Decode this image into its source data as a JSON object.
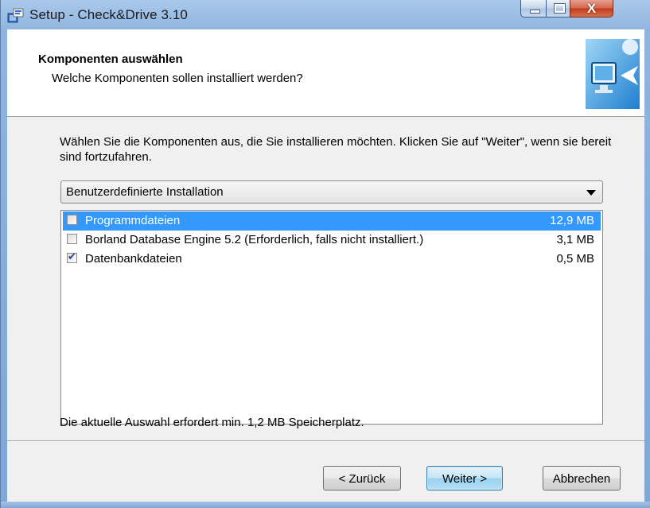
{
  "window": {
    "title": "Setup - Check&Drive 3.10",
    "app_icon": "installer-icon",
    "controls": {
      "minimize": "minimize-icon",
      "maximize": "maximize-icon",
      "close_glyph": "X"
    }
  },
  "header": {
    "title": "Komponenten auswählen",
    "subtitle": "Welche Komponenten sollen installiert werden?",
    "image": "monitor-arrow-icon"
  },
  "body": {
    "description": "Wählen Sie die Komponenten aus, die Sie installieren möchten. Klicken Sie auf \"Weiter\", wenn sie bereit sind fortzufahren.",
    "install_type": {
      "selected": "Benutzerdefinierte Installation"
    },
    "components": [
      {
        "label": "Programmdateien",
        "size": "12,9 MB",
        "checked": false,
        "selected": true
      },
      {
        "label": "Borland Database Engine 5.2 (Erforderlich, falls nicht installiert.)",
        "size": "3,1 MB",
        "checked": false,
        "selected": false
      },
      {
        "label": "Datenbankdateien",
        "size": "0,5 MB",
        "checked": true,
        "selected": false
      }
    ],
    "space_info": "Die aktuelle Auswahl erfordert min. 1,2 MB Speicherplatz."
  },
  "buttons": {
    "back": "< Zurück",
    "next": "Weiter >",
    "cancel": "Abbrechen"
  },
  "colors": {
    "selection": "#3399ff",
    "checkmark": "#2c3f8a",
    "close_button": "#c2391c"
  }
}
